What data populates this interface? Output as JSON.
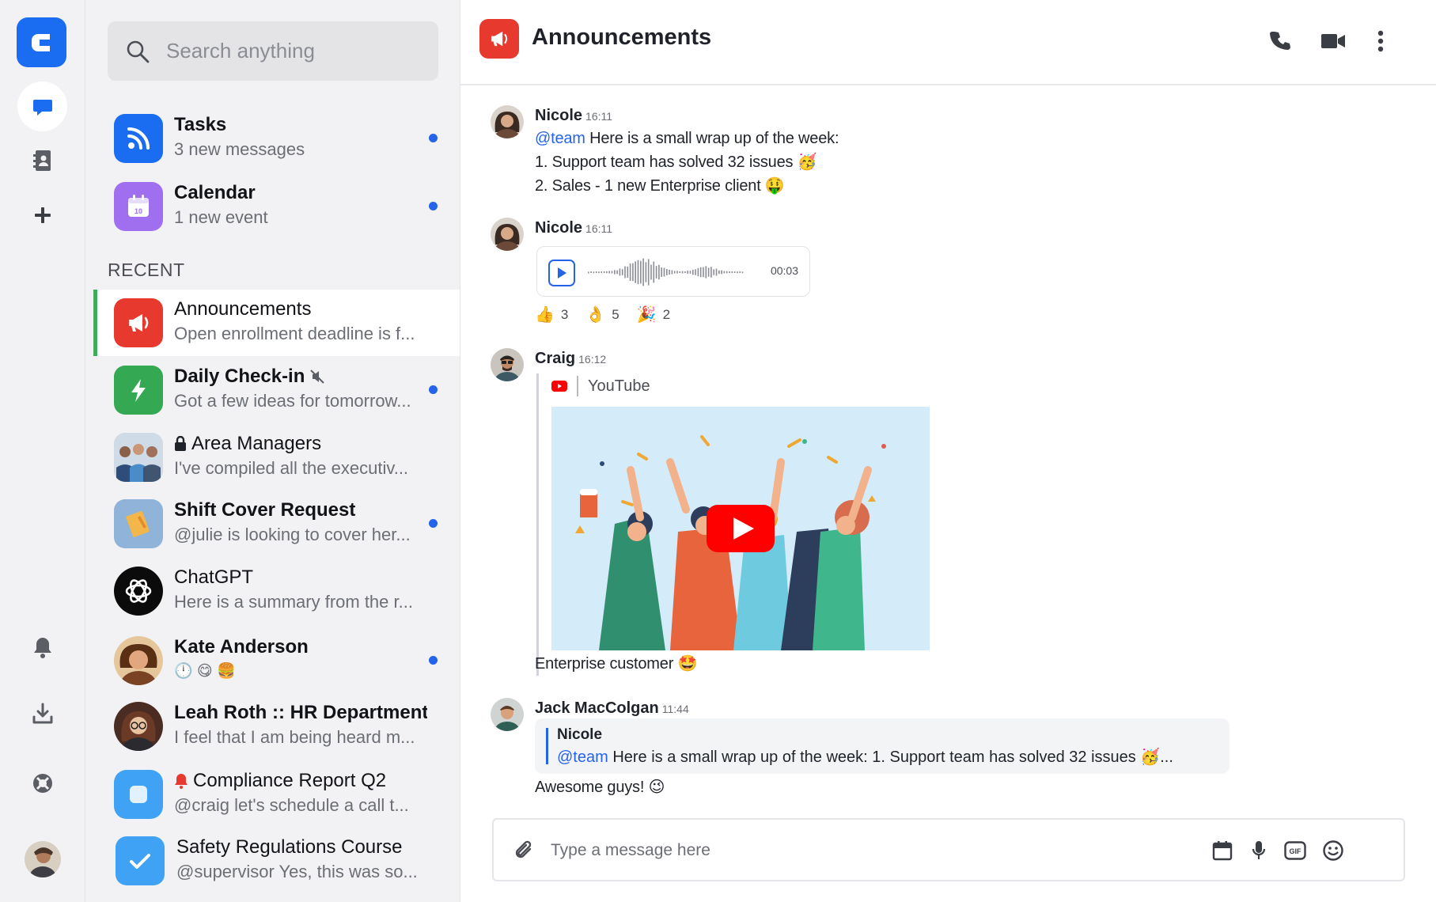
{
  "search": {
    "placeholder": "Search anything"
  },
  "pinned": [
    {
      "title": "Tasks",
      "subtitle": "3 new messages",
      "icon": "rss-icon",
      "color": "#1a6cf0",
      "unread": true
    },
    {
      "title": "Calendar",
      "subtitle": "1 new event",
      "icon": "calendar-icon",
      "color": "#a06ff0",
      "unread": true,
      "badge": "10"
    }
  ],
  "recent_label": "RECENT",
  "conversations": [
    {
      "title": "Announcements",
      "subtitle": "Open enrollment deadline is f...",
      "unread": false,
      "active": true
    },
    {
      "title": "Daily Check-in",
      "subtitle": "Got a few ideas for tomorrow...",
      "unread": true,
      "muted": true
    },
    {
      "title": "Area Managers",
      "subtitle": "I've compiled all the executiv...",
      "unread": false,
      "locked": true
    },
    {
      "title": "Shift Cover Request",
      "subtitle": "@julie is looking to cover her...",
      "unread": true
    },
    {
      "title": "ChatGPT",
      "subtitle": "Here is a summary from the r...",
      "unread": false
    },
    {
      "title": "Kate Anderson",
      "subtitle": "🕛 😋 🍔",
      "unread": true
    },
    {
      "title": "Leah Roth :: HR Department",
      "subtitle": "I feel that I am being heard m...",
      "unread": false
    },
    {
      "title": "Compliance Report Q2",
      "subtitle": "@craig let's schedule a call t...",
      "unread": false,
      "alert": true
    },
    {
      "title": "Safety Regulations Course",
      "subtitle": "@supervisor Yes, this was so...",
      "unread": false
    }
  ],
  "chat": {
    "title": "Announcements",
    "messages": [
      {
        "author": "Nicole",
        "time": "16:11",
        "mention": "@team",
        "first_line": "Here is a small wrap up of the week:",
        "lines": [
          "1. Support team has solved 32 issues 🥳",
          "2. Sales - 1 new Enterprise client 🤑"
        ]
      },
      {
        "author": "Nicole",
        "time": "16:11",
        "audio_duration": "00:03",
        "reactions": [
          {
            "emoji": "👍",
            "count": "3"
          },
          {
            "emoji": "👌",
            "count": "5"
          },
          {
            "emoji": "🎉",
            "count": "2"
          }
        ]
      },
      {
        "author": "Craig",
        "time": "16:12",
        "link_source": "YouTube",
        "caption": "Enterprise customer 🤩"
      },
      {
        "author": "Jack MacColgan",
        "time": "11:44",
        "quote_author": "Nicole",
        "quote_mention": "@team",
        "quote_text": "Here is a small wrap up of the week: 1. Support team has solved 32 issues 🥳...",
        "text": "Awesome guys! 😉"
      }
    ]
  },
  "composer": {
    "placeholder": "Type a message here",
    "gif_label": "GIF"
  }
}
